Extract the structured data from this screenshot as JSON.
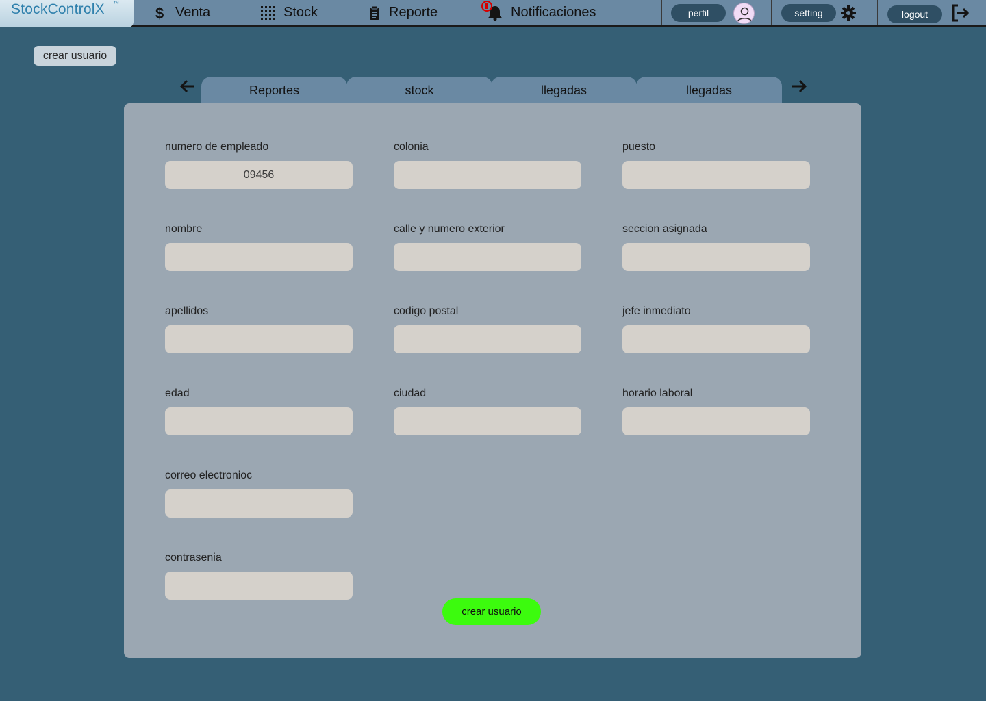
{
  "app": {
    "logo": "StockControlX",
    "logo_mark": "™"
  },
  "nav": {
    "items": [
      {
        "label": "Venta",
        "icon": "dollar-icon"
      },
      {
        "label": "Stock",
        "icon": "grid-icon"
      },
      {
        "label": "Reporte",
        "icon": "clipboard-icon"
      },
      {
        "label": "Notificaciones",
        "icon": "bell-icon"
      }
    ],
    "profile_label": "perfil",
    "setting_label": "setting",
    "logout_label": "logout"
  },
  "page": {
    "create_user_button": "crear usuario"
  },
  "tabs": [
    "Reportes",
    "stock",
    "llegadas",
    "llegadas"
  ],
  "form": {
    "fields": [
      {
        "label": "numero de empleado",
        "value": "09456"
      },
      {
        "label": "nombre",
        "value": ""
      },
      {
        "label": "apellidos",
        "value": ""
      },
      {
        "label": "edad",
        "value": ""
      },
      {
        "label": "correo electronioc",
        "value": ""
      },
      {
        "label": "contrasenia",
        "value": ""
      },
      {
        "label": "colonia",
        "value": ""
      },
      {
        "label": "calle y numero exterior",
        "value": ""
      },
      {
        "label": "codigo postal",
        "value": ""
      },
      {
        "label": "ciudad",
        "value": ""
      },
      {
        "label": "puesto",
        "value": ""
      },
      {
        "label": "seccion asignada",
        "value": ""
      },
      {
        "label": "jefe inmediato",
        "value": ""
      },
      {
        "label": "horario laboral",
        "value": ""
      }
    ],
    "submit_label": "crear usuario"
  },
  "colors": {
    "background": "#355f75",
    "topbar": "#6a89a3",
    "panel": "#9ba7b2",
    "input": "#d5d1cb",
    "submit": "#3cfb0e",
    "notification": "#d40000"
  }
}
